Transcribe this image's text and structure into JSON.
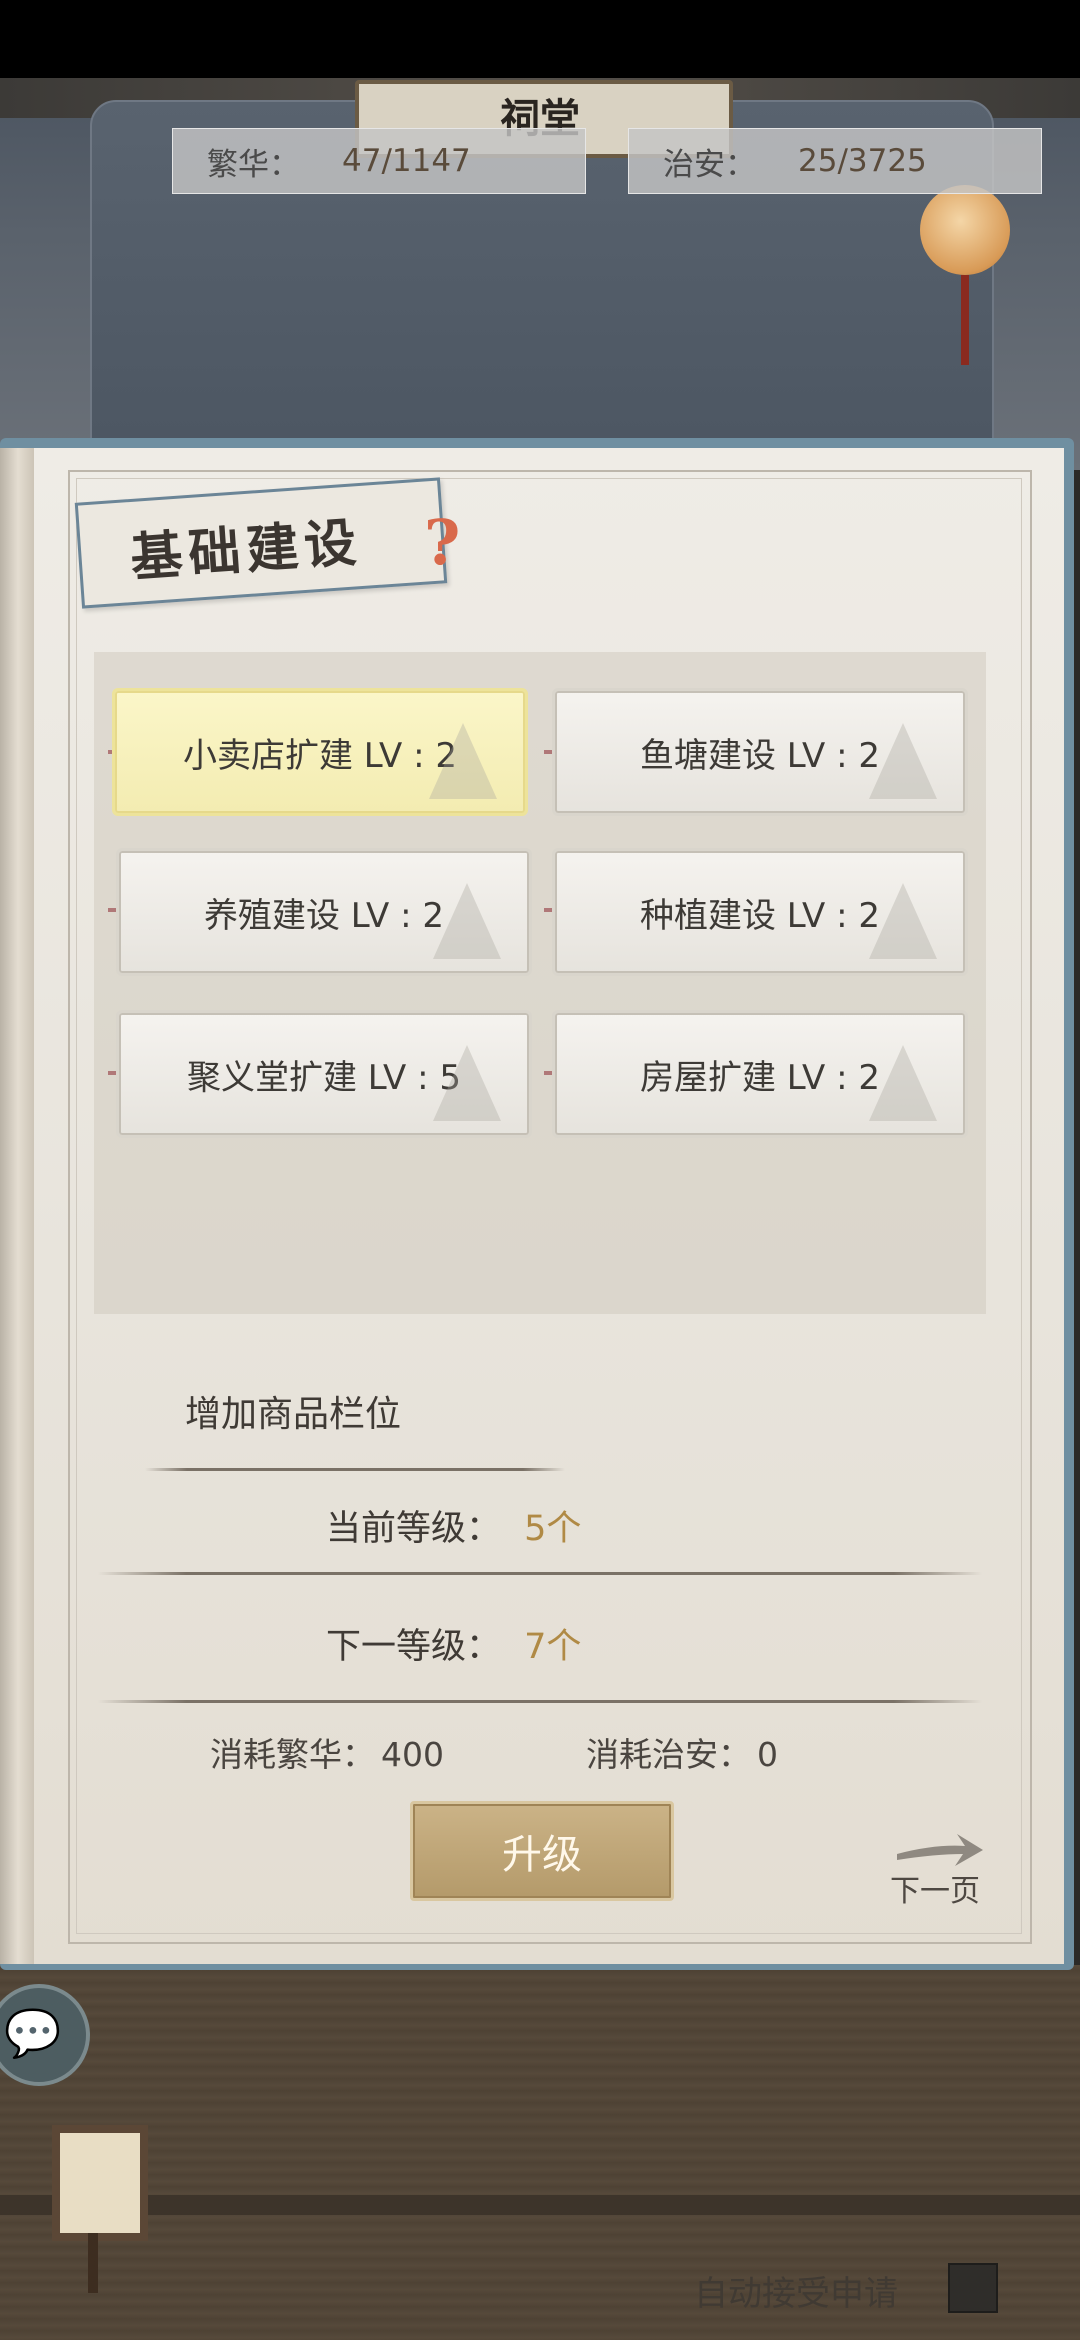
{
  "hall": {
    "sign_text": "祠堂"
  },
  "resources": {
    "prosperity": {
      "label": "繁华：",
      "value": "47/1147"
    },
    "security": {
      "label": "治安：",
      "value": "25/3725"
    }
  },
  "panel": {
    "title": "基础建设",
    "help_icon": "?",
    "buildings": [
      {
        "label": "小卖店扩建 LV : 2",
        "selected": true
      },
      {
        "label": "鱼塘建设 LV : 2",
        "selected": false
      },
      {
        "label": "养殖建设 LV : 2",
        "selected": false
      },
      {
        "label": "种植建设 LV : 2",
        "selected": false
      },
      {
        "label": "聚义堂扩建 LV : 5",
        "selected": false
      },
      {
        "label": "房屋扩建 LV : 2",
        "selected": false
      }
    ],
    "description": "增加商品栏位",
    "current_level": {
      "label": "当前等级：",
      "value": "5个"
    },
    "next_level": {
      "label": "下一等级：",
      "value": "7个"
    },
    "cost_prosperity": {
      "label": "消耗繁华：",
      "value": "400"
    },
    "cost_security": {
      "label": "消耗治安：",
      "value": "0"
    },
    "upgrade_label": "升级",
    "next_page_label": "下一页"
  },
  "footer": {
    "auto_accept_label": "自动接受申请",
    "auto_accept_checked": false
  },
  "icons": {
    "chat": "chat-bubble-icon",
    "help": "question-icon",
    "next": "arrow-right-icon",
    "lamp": "lantern-icon"
  }
}
